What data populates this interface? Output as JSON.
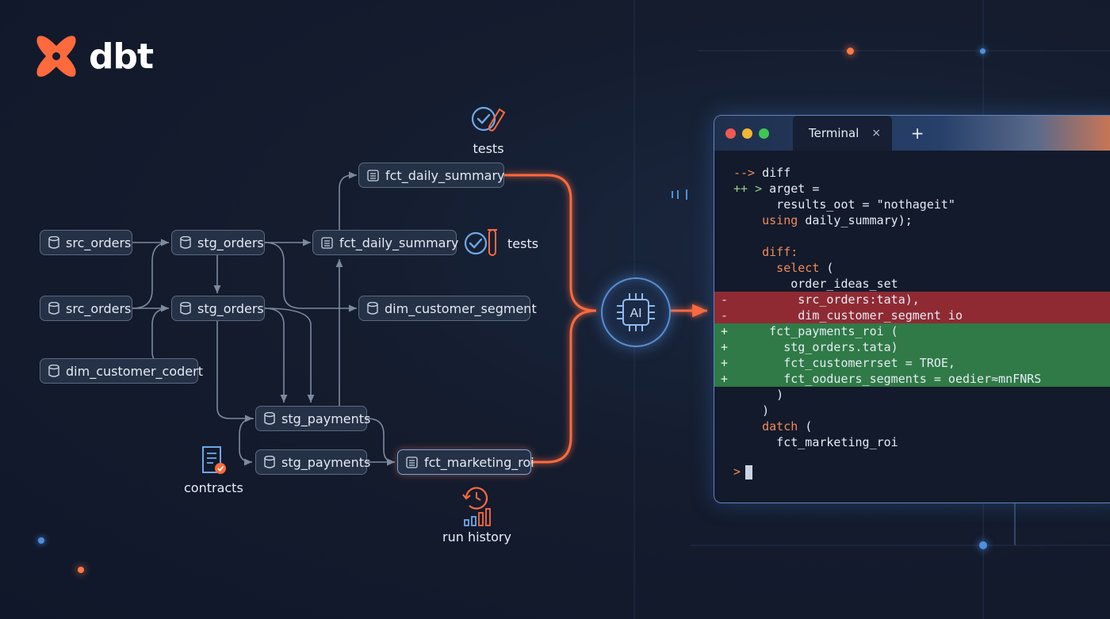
{
  "brand": {
    "name": "dbt"
  },
  "nodes": [
    {
      "id": "n1",
      "label": "src_orders",
      "icon": "database-icon"
    },
    {
      "id": "n2",
      "label": "src_orders",
      "icon": "database-icon"
    },
    {
      "id": "n3",
      "label": "dim_customer_codert",
      "icon": "database-icon"
    },
    {
      "id": "n4",
      "label": "stg_orders",
      "icon": "database-icon"
    },
    {
      "id": "n5",
      "label": "stg_orders",
      "icon": "database-icon"
    },
    {
      "id": "n6",
      "label": "fct_daily_summary",
      "icon": "table-icon"
    },
    {
      "id": "n7",
      "label": "fct_daily_summary",
      "icon": "table-icon"
    },
    {
      "id": "n8",
      "label": "dim_customer_segment",
      "icon": "database-icon"
    },
    {
      "id": "n9",
      "label": "stg_payments",
      "icon": "database-icon"
    },
    {
      "id": "n10",
      "label": "stg_payments",
      "icon": "database-icon"
    },
    {
      "id": "n11",
      "label": "fct_marketing_roi",
      "icon": "table-icon"
    }
  ],
  "callouts": {
    "tests_top": "tests",
    "tests_side": "tests",
    "contracts": "contracts",
    "run_history": "run history"
  },
  "ai": {
    "label": "AI"
  },
  "terminal": {
    "tab_label": "Terminal",
    "close_glyph": "×",
    "new_tab_glyph": "+",
    "prompt_glyph": ">",
    "lines": [
      {
        "kind": "normal",
        "mark": "",
        "segments": [
          {
            "text": "--> ",
            "color": "orange"
          },
          {
            "text": "diff",
            "color": "white"
          }
        ]
      },
      {
        "kind": "normal",
        "mark": "",
        "segments": [
          {
            "text": "++ > ",
            "color": "green"
          },
          {
            "text": "arget =",
            "color": "white"
          }
        ]
      },
      {
        "kind": "normal",
        "mark": "",
        "segments": [
          {
            "text": "      results_oot = \"nothageit\"",
            "color": "white"
          }
        ]
      },
      {
        "kind": "normal",
        "mark": "",
        "segments": [
          {
            "text": "    using ",
            "color": "orange"
          },
          {
            "text": "daily_summary);",
            "color": "white"
          }
        ]
      },
      {
        "kind": "normal",
        "mark": "",
        "segments": [
          {
            "text": "",
            "color": "white"
          }
        ]
      },
      {
        "kind": "normal",
        "mark": "",
        "segments": [
          {
            "text": "    diff:",
            "color": "orange"
          }
        ]
      },
      {
        "kind": "normal",
        "mark": "",
        "segments": [
          {
            "text": "      select ",
            "color": "orange"
          },
          {
            "text": "(",
            "color": "white"
          }
        ]
      },
      {
        "kind": "normal",
        "mark": "",
        "segments": [
          {
            "text": "        order_ideas_set",
            "color": "white"
          }
        ]
      },
      {
        "kind": "del",
        "mark": "-",
        "segments": [
          {
            "text": "         src_orders:tata),",
            "color": "white"
          }
        ]
      },
      {
        "kind": "del",
        "mark": "-",
        "segments": [
          {
            "text": "         dim_customer_segment io",
            "color": "white"
          }
        ]
      },
      {
        "kind": "add",
        "mark": "+",
        "segments": [
          {
            "text": "     fct_payments_roi (",
            "color": "white"
          }
        ]
      },
      {
        "kind": "add",
        "mark": "+",
        "segments": [
          {
            "text": "       stg_orders.tata)",
            "color": "white"
          }
        ]
      },
      {
        "kind": "add",
        "mark": "+",
        "segments": [
          {
            "text": "       fct_customerrset = TROE,",
            "color": "white"
          }
        ]
      },
      {
        "kind": "add",
        "mark": "+",
        "segments": [
          {
            "text": "       fct_ooduers_segments = oedier≈mnFNRS",
            "color": "white"
          }
        ]
      },
      {
        "kind": "normal",
        "mark": "",
        "segments": [
          {
            "text": "      )",
            "color": "white"
          }
        ]
      },
      {
        "kind": "normal",
        "mark": "",
        "segments": [
          {
            "text": "    )",
            "color": "white"
          }
        ]
      },
      {
        "kind": "normal",
        "mark": "",
        "segments": [
          {
            "text": "    datch ",
            "color": "orange"
          },
          {
            "text": "(",
            "color": "white"
          }
        ]
      },
      {
        "kind": "normal",
        "mark": "",
        "segments": [
          {
            "text": "      fct_marketing_roi",
            "color": "white"
          }
        ]
      }
    ]
  },
  "colors": {
    "accent_orange": "#ff6a3d",
    "accent_blue": "#4f8fe0",
    "edge": "#7c8aa0",
    "diff_del": "#8f2a33",
    "diff_add": "#2f7a46"
  }
}
